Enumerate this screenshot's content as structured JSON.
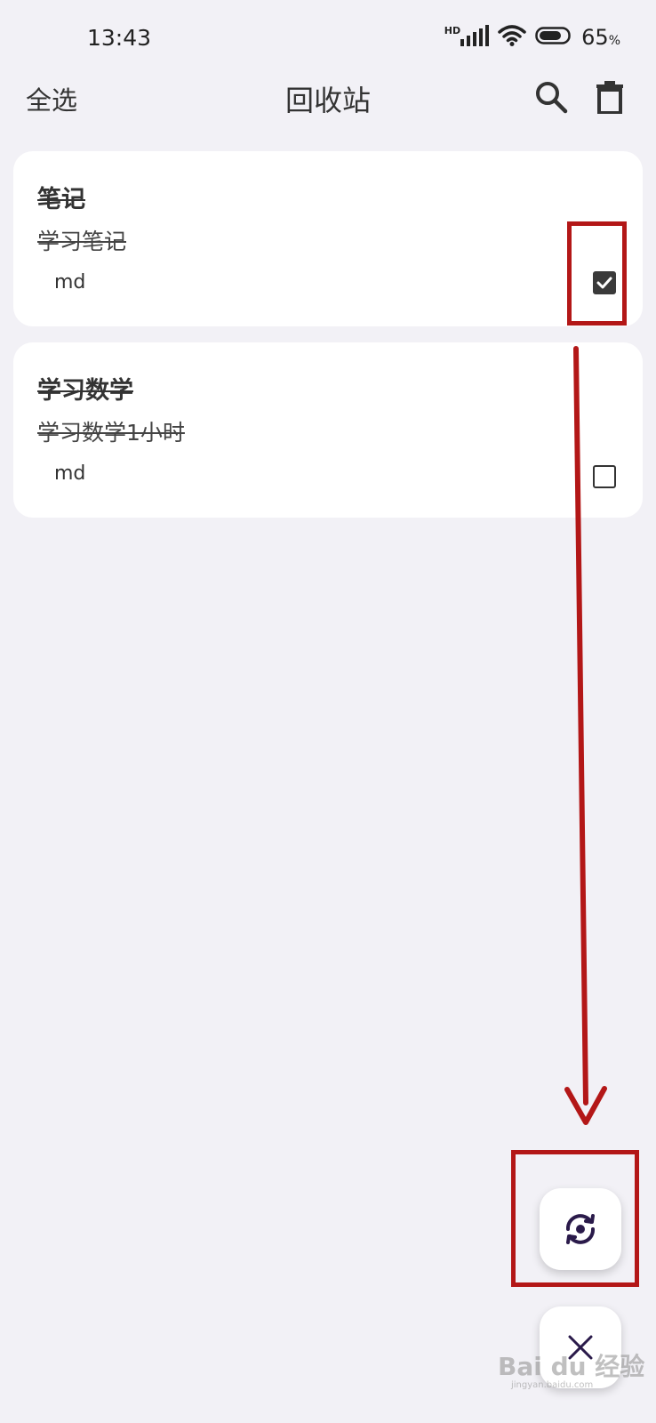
{
  "status_bar": {
    "time": "13:43",
    "network_label": "HD",
    "battery_percent": "65",
    "battery_unit": "%",
    "icons": [
      "signal-icon",
      "wifi-icon",
      "battery-icon"
    ]
  },
  "app_bar": {
    "select_all_label": "全选",
    "title": "回收站",
    "icons": [
      "search-icon",
      "trash-icon"
    ]
  },
  "notes": [
    {
      "title": "笔记",
      "body": "学习笔记",
      "tag": "md",
      "checked": true
    },
    {
      "title": "学习数学",
      "body": "学习数学1小时",
      "tag": "md",
      "checked": false
    }
  ],
  "fabs": {
    "icons": [
      "restore-icon",
      "close-icon"
    ]
  },
  "watermark": {
    "text": "Bai du 经验",
    "sub": "jingyan.baidu.com"
  },
  "colors": {
    "background": "#f2f1f6",
    "card": "#ffffff",
    "annotation": "#b31717",
    "fab_icon": "#2a1a4a"
  }
}
